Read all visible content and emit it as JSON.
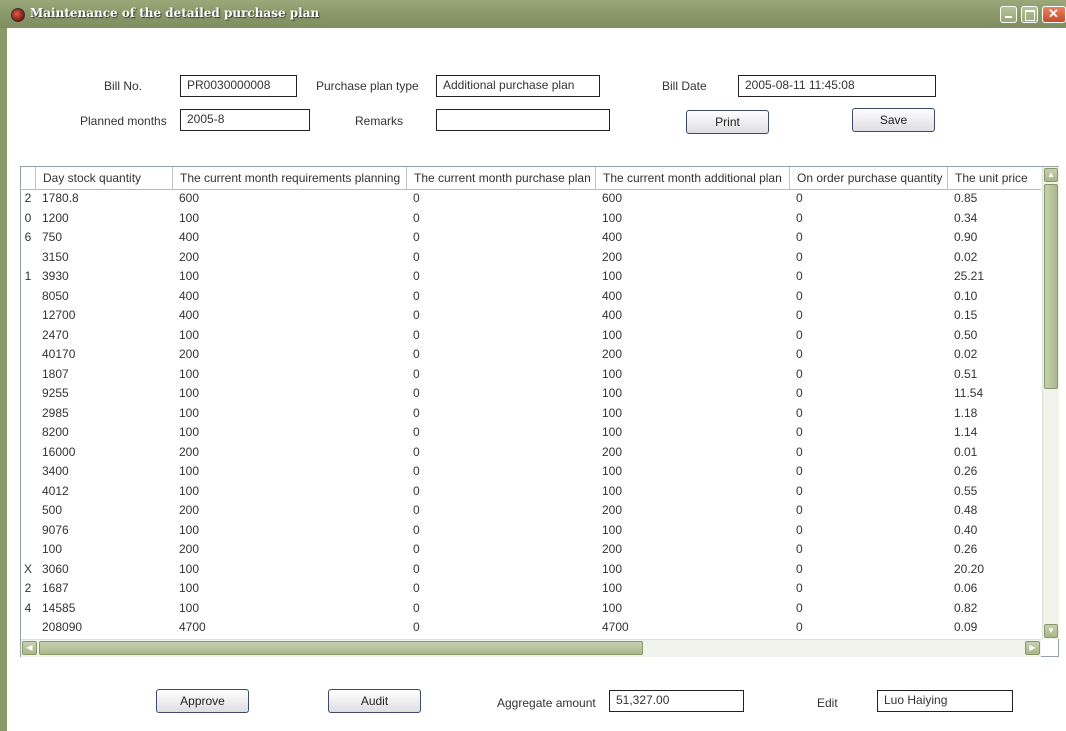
{
  "window": {
    "title": "Maintenance of the detailed purchase plan"
  },
  "form": {
    "bill_no_label": "Bill No.",
    "bill_no": "PR0030000008",
    "purchase_plan_type_label": "Purchase plan type",
    "purchase_plan_type": "Additional purchase plan",
    "bill_date_label": "Bill Date",
    "bill_date": "2005-08-11 11:45:08",
    "planned_months_label": "Planned months",
    "planned_months": "2005-8",
    "remarks_label": "Remarks",
    "remarks": "",
    "print_label": "Print",
    "save_label": "Save"
  },
  "grid": {
    "columns": [
      "Day stock quantity",
      "The current month requirements planning",
      "The current month purchase plan",
      "The current month additional plan",
      "On order purchase quantity",
      "The unit price"
    ],
    "rows": [
      {
        "marker": "2",
        "cells": [
          "1780.8",
          "600",
          "0",
          "600",
          "0",
          "0.85"
        ]
      },
      {
        "marker": "0",
        "cells": [
          "1200",
          "100",
          "0",
          "100",
          "0",
          "0.34"
        ]
      },
      {
        "marker": "6",
        "cells": [
          "750",
          "400",
          "0",
          "400",
          "0",
          "0.90"
        ]
      },
      {
        "marker": "",
        "cells": [
          "3150",
          "200",
          "0",
          "200",
          "0",
          "0.02"
        ]
      },
      {
        "marker": "1",
        "cells": [
          "3930",
          "100",
          "0",
          "100",
          "0",
          "25.21"
        ]
      },
      {
        "marker": "",
        "cells": [
          "8050",
          "400",
          "0",
          "400",
          "0",
          "0.10"
        ]
      },
      {
        "marker": "",
        "cells": [
          "12700",
          "400",
          "0",
          "400",
          "0",
          "0.15"
        ]
      },
      {
        "marker": "",
        "cells": [
          "2470",
          "100",
          "0",
          "100",
          "0",
          "0.50"
        ]
      },
      {
        "marker": "",
        "cells": [
          "40170",
          "200",
          "0",
          "200",
          "0",
          "0.02"
        ]
      },
      {
        "marker": "",
        "cells": [
          "1807",
          "100",
          "0",
          "100",
          "0",
          "0.51"
        ]
      },
      {
        "marker": "",
        "cells": [
          "9255",
          "100",
          "0",
          "100",
          "0",
          "11.54"
        ]
      },
      {
        "marker": "",
        "cells": [
          "2985",
          "100",
          "0",
          "100",
          "0",
          "1.18"
        ]
      },
      {
        "marker": "",
        "cells": [
          "8200",
          "100",
          "0",
          "100",
          "0",
          "1.14"
        ]
      },
      {
        "marker": "",
        "cells": [
          "16000",
          "200",
          "0",
          "200",
          "0",
          "0.01"
        ]
      },
      {
        "marker": "",
        "cells": [
          "3400",
          "100",
          "0",
          "100",
          "0",
          "0.26"
        ]
      },
      {
        "marker": "",
        "cells": [
          "4012",
          "100",
          "0",
          "100",
          "0",
          "0.55"
        ]
      },
      {
        "marker": "",
        "cells": [
          "500",
          "200",
          "0",
          "200",
          "0",
          "0.48"
        ]
      },
      {
        "marker": "",
        "cells": [
          "9076",
          "100",
          "0",
          "100",
          "0",
          "0.40"
        ]
      },
      {
        "marker": "",
        "cells": [
          "100",
          "200",
          "0",
          "200",
          "0",
          "0.26"
        ]
      },
      {
        "marker": "X",
        "cells": [
          "3060",
          "100",
          "0",
          "100",
          "0",
          "20.20"
        ]
      },
      {
        "marker": "2",
        "cells": [
          "1687",
          "100",
          "0",
          "100",
          "0",
          "0.06"
        ]
      },
      {
        "marker": "4",
        "cells": [
          "14585",
          "100",
          "0",
          "100",
          "0",
          "0.82"
        ]
      },
      {
        "marker": "",
        "cells": [
          "208090",
          "4700",
          "0",
          "4700",
          "0",
          "0.09"
        ]
      }
    ]
  },
  "footer": {
    "approve_label": "Approve",
    "audit_label": "Audit",
    "aggregate_amount_label": "Aggregate amount",
    "aggregate_amount": "51,327.00",
    "edit_label": "Edit",
    "editor": "Luo Haiying"
  }
}
